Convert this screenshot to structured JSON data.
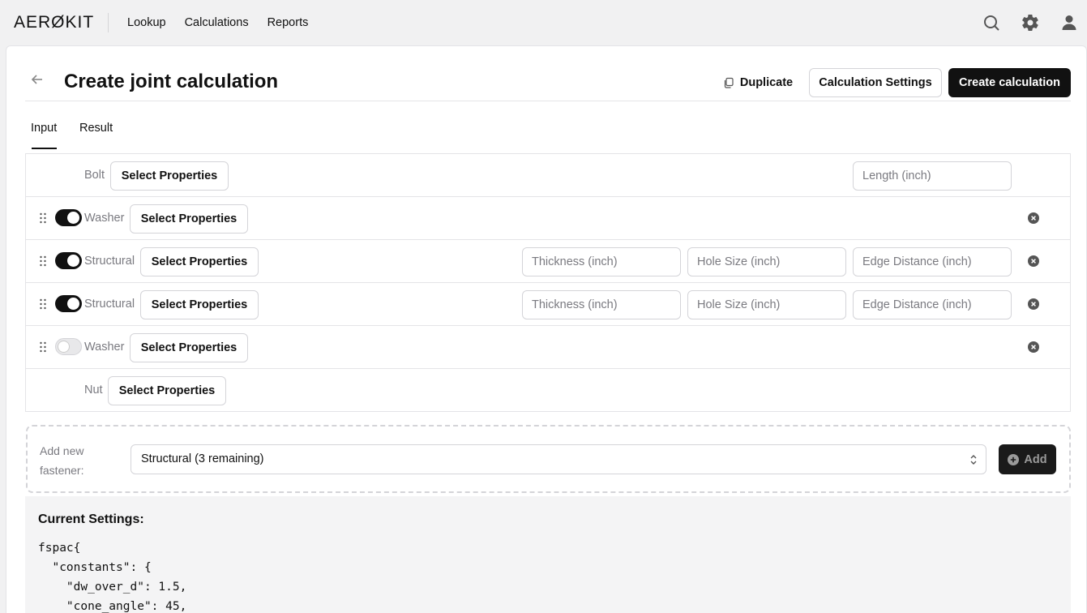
{
  "app": {
    "logo": "AERØKIT"
  },
  "nav": [
    "Lookup",
    "Calculations",
    "Reports"
  ],
  "top_icons": [
    "search-icon",
    "gear-icon",
    "user-icon"
  ],
  "page": {
    "title": "Create joint calculation",
    "duplicate_label": "Duplicate",
    "settings_label": "Calculation Settings",
    "create_label": "Create calculation"
  },
  "tabs": {
    "input": "Input",
    "result": "Result",
    "active": "Input"
  },
  "rows": [
    {
      "type": "Bolt",
      "button": "Select Properties",
      "fields": [
        "Length (inch)"
      ],
      "removable": false,
      "toggle": null
    },
    {
      "type": "Washer",
      "button": "Select Properties",
      "fields": [],
      "removable": true,
      "toggle": true
    },
    {
      "type": "Structural",
      "button": "Select Properties",
      "fields": [
        "Thickness (inch)",
        "Hole Size (inch)",
        "Edge Distance (inch)"
      ],
      "removable": true,
      "toggle": true
    },
    {
      "type": "Structural",
      "button": "Select Properties",
      "fields": [
        "Thickness (inch)",
        "Hole Size (inch)",
        "Edge Distance (inch)"
      ],
      "removable": true,
      "toggle": true
    },
    {
      "type": "Washer",
      "button": "Select Properties",
      "fields": [],
      "removable": true,
      "toggle": false
    },
    {
      "type": "Nut",
      "button": "Select Properties",
      "fields": [],
      "removable": false,
      "toggle": null
    }
  ],
  "add_fastener": {
    "label": "Add new fastener:",
    "selected": "Structural (3 remaining)",
    "button": "Add"
  },
  "current_settings": {
    "title": "Current Settings:",
    "code": "fspac{\n  \"constants\": {\n    \"dw_over_d\": 1.5,\n    \"cone_angle\": 45,"
  },
  "colors": {
    "primary": "#111111",
    "border": "#d4d4d8",
    "muted": "#7a7a80"
  }
}
